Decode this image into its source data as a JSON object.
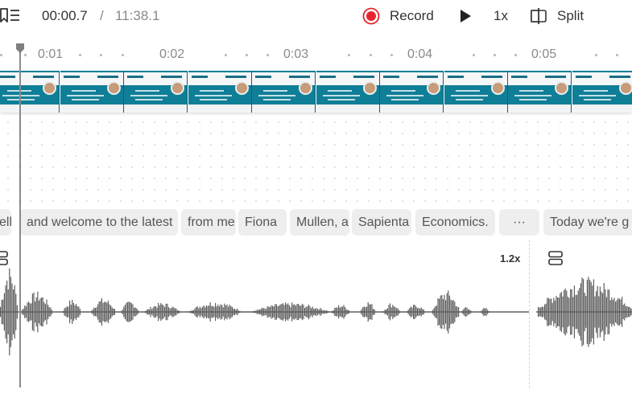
{
  "toolbar": {
    "time_current": "00:00.7",
    "time_separator": "/",
    "time_total": "11:38.1",
    "record_label": "Record",
    "speed_label": "1x",
    "split_label": "Split"
  },
  "ruler": {
    "ticks": [
      "0:01",
      "0:02",
      "0:03",
      "0:04",
      "0:05"
    ]
  },
  "transcript": {
    "chips": [
      "ello",
      "and welcome to the latest",
      "from me",
      "Fiona",
      "Mullen, a",
      "Sapienta",
      "Economics.",
      "···",
      "Today we're g"
    ]
  },
  "audio": {
    "clip_speed": "1.2x"
  },
  "colors": {
    "record_red": "#e3262f",
    "video_teal": "#0f7f97",
    "waveform_gray": "#5f5f5f",
    "chip_bg": "#eeeeee"
  },
  "icons": {
    "bookmark": "bookmark-list-icon",
    "record": "record-icon",
    "play": "play-icon",
    "split": "split-icon",
    "clip": "clip-stack-icon"
  }
}
